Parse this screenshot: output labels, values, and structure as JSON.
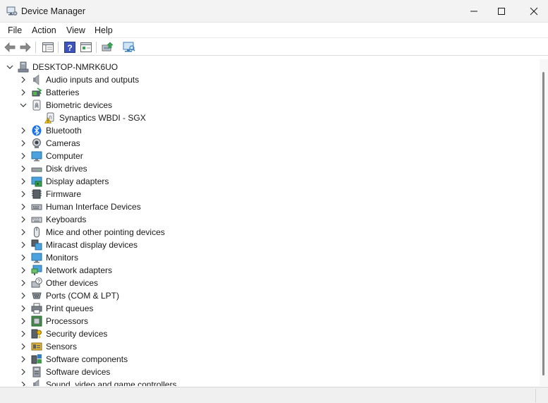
{
  "window": {
    "title": "Device Manager"
  },
  "menu": [
    {
      "label": "File"
    },
    {
      "label": "Action"
    },
    {
      "label": "View"
    },
    {
      "label": "Help"
    }
  ],
  "toolbar_icons": [
    "back-arrow-icon",
    "forward-arrow-icon",
    "show-hide-console-tree-icon",
    "help-icon",
    "properties-icon",
    "update-driver-icon",
    "scan-hardware-icon"
  ],
  "tree": {
    "root": {
      "label": "DESKTOP-NMRK6UO",
      "icon": "computer-tree-icon",
      "expanded": true
    },
    "items": [
      {
        "label": "Audio inputs and outputs",
        "icon": "speaker-icon",
        "expanded": false
      },
      {
        "label": "Batteries",
        "icon": "battery-icon",
        "expanded": false
      },
      {
        "label": "Biometric devices",
        "icon": "fingerprint-icon",
        "expanded": true,
        "children": [
          {
            "label": "Synaptics WBDI - SGX",
            "icon": "warning-device-icon"
          }
        ]
      },
      {
        "label": "Bluetooth",
        "icon": "bluetooth-icon",
        "expanded": false
      },
      {
        "label": "Cameras",
        "icon": "camera-icon",
        "expanded": false
      },
      {
        "label": "Computer",
        "icon": "monitor-icon",
        "expanded": false
      },
      {
        "label": "Disk drives",
        "icon": "disk-drive-icon",
        "expanded": false
      },
      {
        "label": "Display adapters",
        "icon": "display-adapter-icon",
        "expanded": false
      },
      {
        "label": "Firmware",
        "icon": "chip-icon",
        "expanded": false
      },
      {
        "label": "Human Interface Devices",
        "icon": "hid-icon",
        "expanded": false
      },
      {
        "label": "Keyboards",
        "icon": "keyboard-icon",
        "expanded": false
      },
      {
        "label": "Mice and other pointing devices",
        "icon": "mouse-icon",
        "expanded": false
      },
      {
        "label": "Miracast display devices",
        "icon": "miracast-icon",
        "expanded": false
      },
      {
        "label": "Monitors",
        "icon": "monitor-icon",
        "expanded": false
      },
      {
        "label": "Network adapters",
        "icon": "network-icon",
        "expanded": false
      },
      {
        "label": "Other devices",
        "icon": "unknown-device-icon",
        "expanded": false
      },
      {
        "label": "Ports (COM & LPT)",
        "icon": "port-icon",
        "expanded": false
      },
      {
        "label": "Print queues",
        "icon": "printer-icon",
        "expanded": false
      },
      {
        "label": "Processors",
        "icon": "processor-icon",
        "expanded": false
      },
      {
        "label": "Security devices",
        "icon": "security-key-icon",
        "expanded": false
      },
      {
        "label": "Sensors",
        "icon": "sensor-icon",
        "expanded": false
      },
      {
        "label": "Software components",
        "icon": "software-component-icon",
        "expanded": false
      },
      {
        "label": "Software devices",
        "icon": "software-device-icon",
        "expanded": false
      },
      {
        "label": "Sound, video and game controllers",
        "icon": "sound-icon",
        "expanded": false
      }
    ]
  },
  "colors": {
    "titlebar": "#f3f3f3",
    "accent_blue": "#1a73e8",
    "warning": "#f5c400"
  }
}
